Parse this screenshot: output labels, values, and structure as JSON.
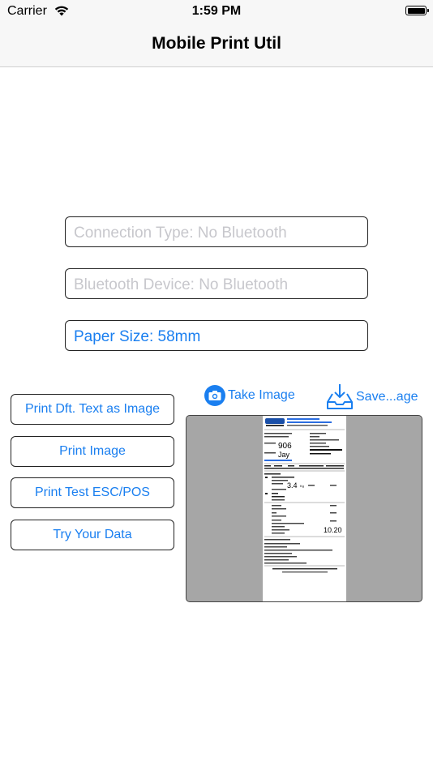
{
  "status_bar": {
    "carrier": "Carrier",
    "time": "1:59 PM"
  },
  "nav": {
    "title": "Mobile Print Util"
  },
  "fields": {
    "connection_type": "Connection Type: No Bluetooth",
    "bluetooth_device": "Bluetooth Device: No Bluetooth",
    "paper_size": "Paper Size: 58mm"
  },
  "buttons": {
    "print_default_text": "Print Dft. Text as Image",
    "print_image": "Print Image",
    "print_test": "Print Test ESC/POS",
    "try_data": "Try Your Data"
  },
  "actions": {
    "take_image": "Take Image",
    "save_image": "Save...age"
  },
  "receipt": {
    "order_no": "906",
    "customer": "Jay",
    "weight": "3.4",
    "weight_unit": "Kg",
    "total": "10.20"
  },
  "colors": {
    "accent": "#1a7ff0",
    "placeholder": "#c7c7cc",
    "preview_bg": "#a6a6a6"
  }
}
